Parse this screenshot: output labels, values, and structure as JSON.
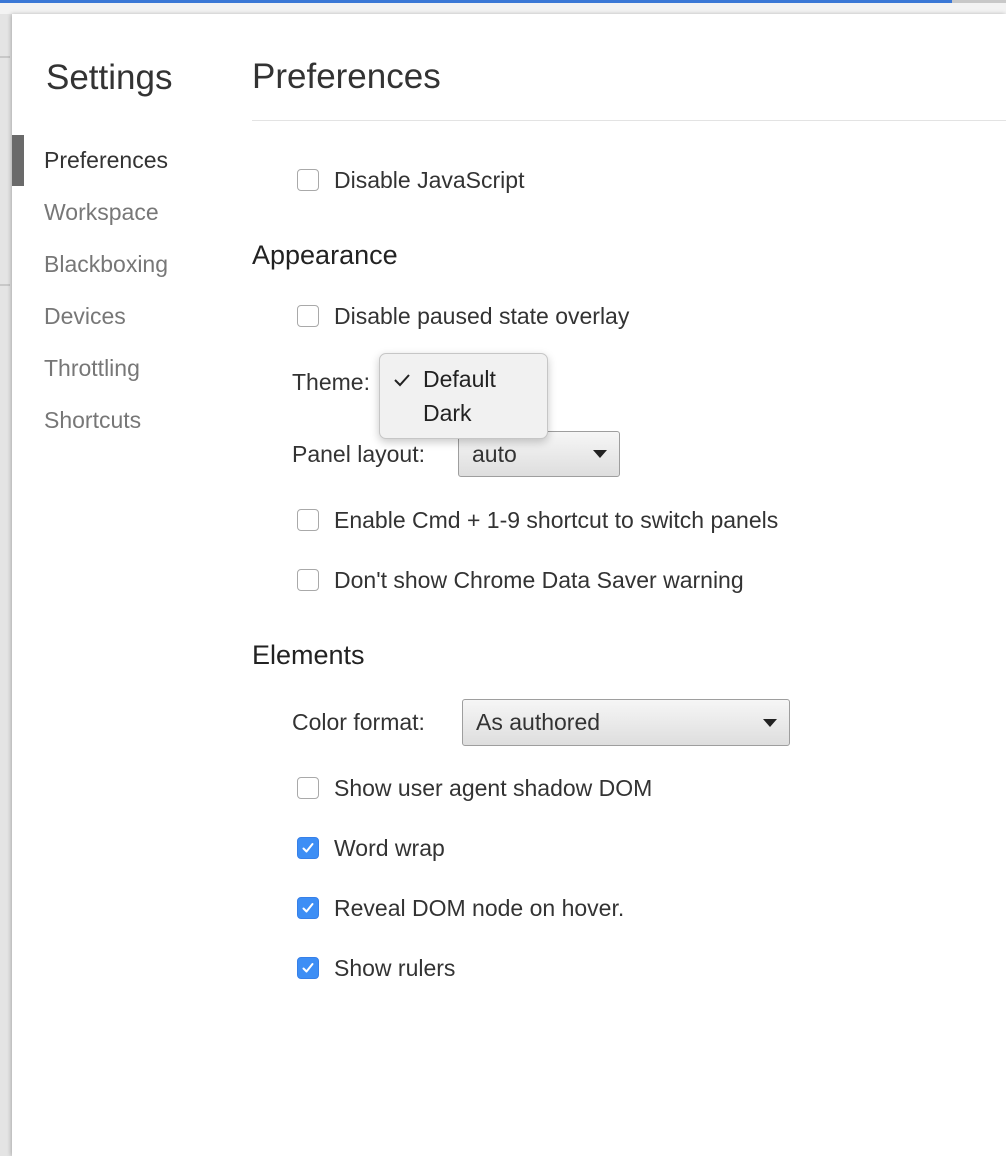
{
  "sidebar": {
    "title": "Settings",
    "items": [
      {
        "label": "Preferences"
      },
      {
        "label": "Workspace"
      },
      {
        "label": "Blackboxing"
      },
      {
        "label": "Devices"
      },
      {
        "label": "Throttling"
      },
      {
        "label": "Shortcuts"
      }
    ],
    "selected": "Preferences"
  },
  "main": {
    "title": "Preferences",
    "general": {
      "disable_javascript": {
        "label": "Disable JavaScript",
        "checked": false
      }
    },
    "appearance": {
      "title": "Appearance",
      "disable_paused_overlay": {
        "label": "Disable paused state overlay",
        "checked": false
      },
      "theme_label": "Theme:",
      "theme_options": [
        "Default",
        "Dark"
      ],
      "theme_selected": "Default",
      "panel_layout_label": "Panel layout:",
      "panel_layout_value": "auto",
      "enable_cmd_shortcut": {
        "label": "Enable Cmd + 1-9 shortcut to switch panels",
        "checked": false
      },
      "data_saver_warning": {
        "label": "Don't show Chrome Data Saver warning",
        "checked": false
      }
    },
    "elements": {
      "title": "Elements",
      "color_format_label": "Color format:",
      "color_format_value": "As authored",
      "show_shadow_dom": {
        "label": "Show user agent shadow DOM",
        "checked": false
      },
      "word_wrap": {
        "label": "Word wrap",
        "checked": true
      },
      "reveal_dom_node": {
        "label": "Reveal DOM node on hover.",
        "checked": true
      },
      "show_rulers": {
        "label": "Show rulers",
        "checked": true
      }
    }
  },
  "colors": {
    "checkbox_checked": "#3d8ef5",
    "selection_indicator": "#6a6a6a",
    "window_accent": "#3b78d6"
  }
}
